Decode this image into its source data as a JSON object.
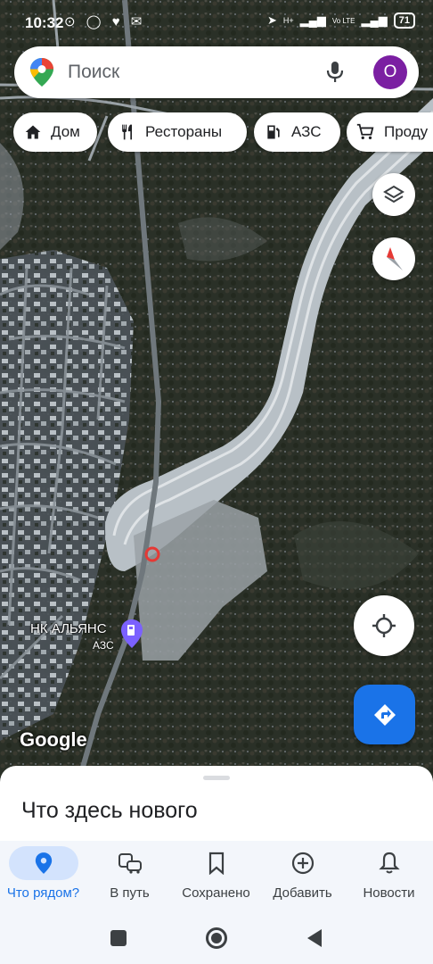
{
  "status_bar": {
    "time": "10:32",
    "battery": "71",
    "network_badge": "H+",
    "volte_badge": "Vo LTE"
  },
  "search": {
    "placeholder": "Поиск",
    "avatar_letter": "O"
  },
  "chips": [
    {
      "label": "Дом",
      "icon": "home-icon"
    },
    {
      "label": "Рестораны",
      "icon": "restaurant-icon"
    },
    {
      "label": "АЗС",
      "icon": "gas-station-icon"
    },
    {
      "label": "Проду",
      "icon": "shopping-cart-icon"
    }
  ],
  "map": {
    "place_label": "НК АЛЬЯНС",
    "place_category": "АЗС",
    "watermark": "Google"
  },
  "sheet": {
    "title": "Что здесь нового"
  },
  "bottom_nav": [
    {
      "label": "Что рядом?",
      "icon": "location-pin-icon",
      "active": true
    },
    {
      "label": "В путь",
      "icon": "commute-icon",
      "active": false
    },
    {
      "label": "Сохранено",
      "icon": "bookmark-icon",
      "active": false
    },
    {
      "label": "Добавить",
      "icon": "add-circle-icon",
      "active": false
    },
    {
      "label": "Новости",
      "icon": "bell-icon",
      "active": false
    }
  ],
  "colors": {
    "accent": "#1a73e8",
    "avatar": "#7b1fa2",
    "active_pill": "#d3e3fd"
  }
}
